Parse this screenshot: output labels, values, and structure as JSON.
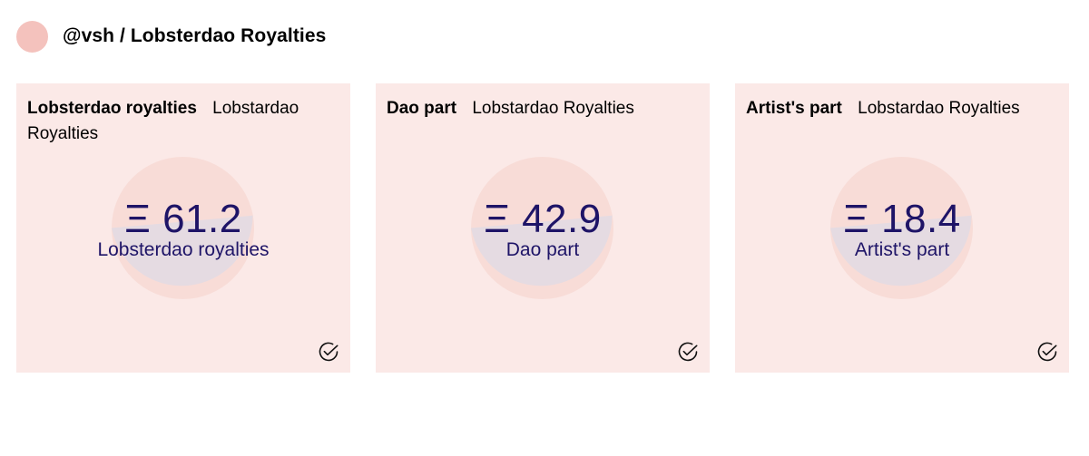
{
  "header": {
    "title": "@vsh / Lobsterdao Royalties"
  },
  "colors": {
    "card_background": "#fbe9e7",
    "avatar": "#f4c2bd",
    "value_text": "#1e1467",
    "donut_primary": "#f8dcd7",
    "donut_secondary": "#e5dbe2"
  },
  "cards": [
    {
      "title": "Lobsterdao royalties",
      "subtitle": "Lobstardao Royalties",
      "value": "Ξ 61.2",
      "label": "Lobsterdao royalties",
      "icon": "check-circle-icon"
    },
    {
      "title": "Dao part",
      "subtitle": "Lobstardao Royalties",
      "value": "Ξ 42.9",
      "label": "Dao part",
      "icon": "check-circle-icon"
    },
    {
      "title": "Artist's part",
      "subtitle": "Lobstardao Royalties",
      "value": "Ξ 18.4",
      "label": "Artist's part",
      "icon": "check-circle-icon"
    }
  ]
}
